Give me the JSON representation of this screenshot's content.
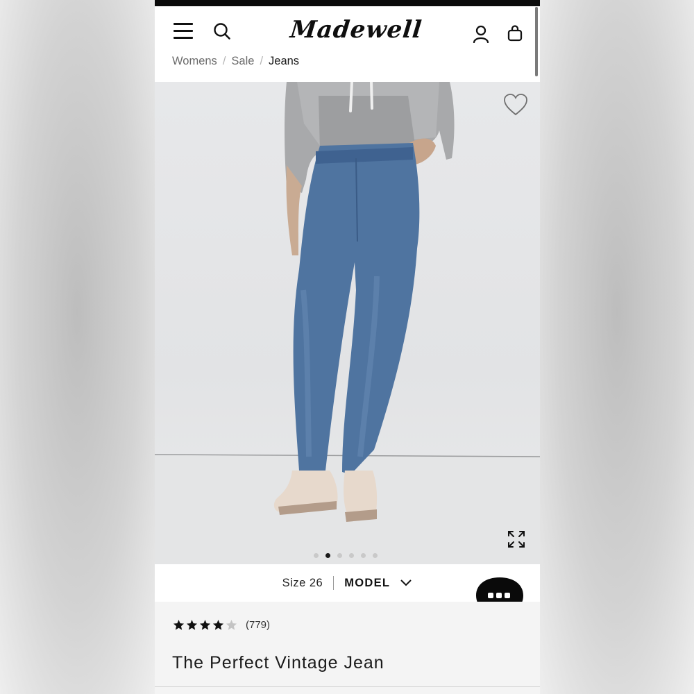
{
  "brand": {
    "logo_text": "Madewell"
  },
  "header": {
    "menu_icon": "hamburger-menu-icon",
    "search_icon": "search-icon",
    "account_icon": "account-icon",
    "bag_icon": "shopping-bag-icon"
  },
  "breadcrumb": {
    "items": [
      {
        "label": "Womens"
      },
      {
        "label": "Sale"
      },
      {
        "label": "Jeans"
      }
    ],
    "separator": "/"
  },
  "gallery": {
    "favorite_icon": "heart-icon",
    "expand_icon": "expand-icon",
    "slide_count": 6,
    "active_slide": 2
  },
  "size_info": {
    "size_label": "Size 26",
    "toggle_label": "MODEL"
  },
  "chat": {
    "icon": "chat-bubble-icon"
  },
  "product": {
    "rating": 4,
    "rating_max": 5,
    "review_count": "(779)",
    "title": "The Perfect Vintage Jean"
  },
  "colors": {
    "text_primary": "#1a1a1a",
    "text_secondary": "#6b6b6b",
    "denim": "#4f74a0",
    "background_info": "#f4f4f4"
  }
}
